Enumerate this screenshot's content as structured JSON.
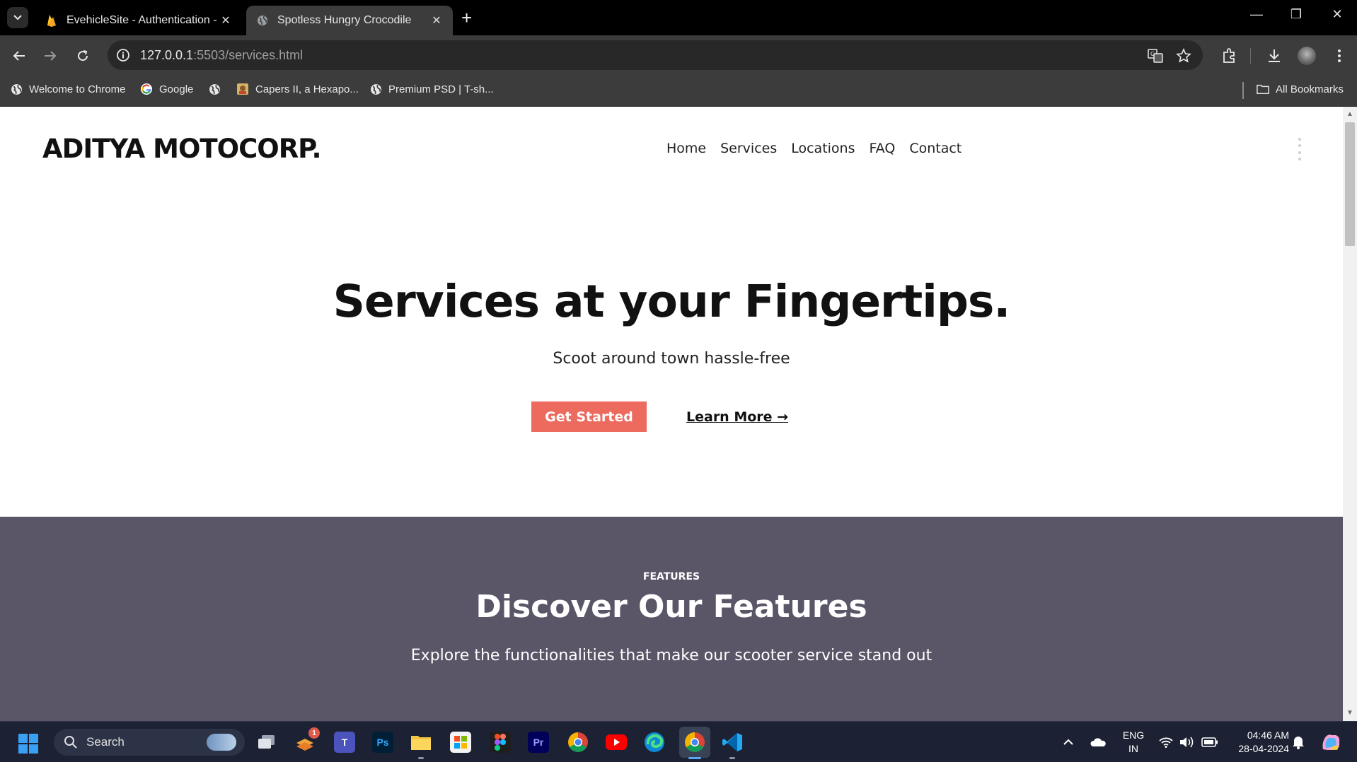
{
  "browser": {
    "tabs": [
      {
        "title": "EvehicleSite - Authentication - F",
        "active": false,
        "icon": "firebase-icon"
      },
      {
        "title": "Spotless Hungry Crocodile",
        "active": true,
        "icon": "globe-icon"
      }
    ],
    "url_host": "127.0.0.1",
    "url_rest": ":5503/services.html",
    "bookmarks": [
      {
        "label": "Welcome to Chrome",
        "icon": "globe-icon"
      },
      {
        "label": "Google",
        "icon": "google-icon"
      },
      {
        "label": "",
        "icon": "globe-icon"
      },
      {
        "label": "Capers II, a Hexapo...",
        "icon": "bookmark-thumb-icon"
      },
      {
        "label": "Premium PSD | T-sh...",
        "icon": "globe-icon"
      }
    ],
    "all_bookmarks_label": "All Bookmarks"
  },
  "site": {
    "brand": "ADITYA MOTOCORP.",
    "nav": [
      "Home",
      "Services",
      "Locations",
      "FAQ",
      "Contact"
    ],
    "hero": {
      "title": "Services at your Fingertips.",
      "subtitle": "Scoot around town hassle-free",
      "primary_cta": "Get Started",
      "secondary_cta": "Learn More →"
    },
    "features": {
      "eyebrow": "FEATURES",
      "title": "Discover Our Features",
      "subtitle": "Explore the functionalities that make our scooter service stand out"
    },
    "colors": {
      "accent": "#ec6a5e",
      "features_bg": "#5b5568"
    }
  },
  "taskbar": {
    "search_label": "Search",
    "notification_count": "1",
    "lang_line1": "ENG",
    "lang_line2": "IN",
    "time": "04:46 AM",
    "date": "28-04-2024"
  }
}
